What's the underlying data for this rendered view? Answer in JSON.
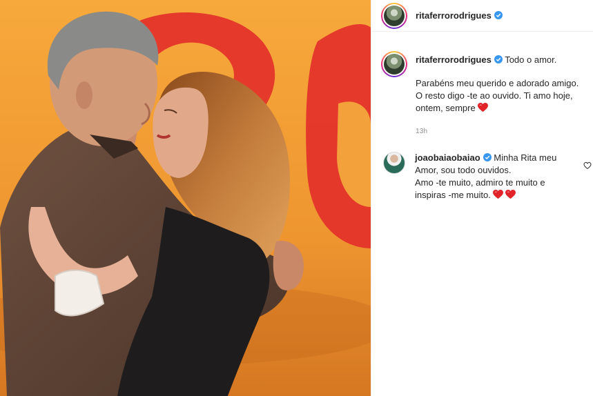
{
  "post": {
    "author": {
      "username": "ritaferrorodrigues",
      "verified": true
    },
    "caption": {
      "username": "ritaferrorodrigues",
      "first_line": "Todo o amor.",
      "lines": [
        "Parabéns meu querido e adorado amigo.",
        "O resto digo -te ao ouvido. Ti amo hoje,",
        "ontem, sempre"
      ],
      "emoji": "red-heart",
      "time": "13h"
    },
    "comments": [
      {
        "username": "joaobaiaobaiao",
        "verified": true,
        "lines": [
          "Minha Rita meu",
          "Amor, sou todo ouvidos.",
          "Amo -te muito, admiro te muito e",
          "inspiras -me muito."
        ],
        "emoji": [
          "red-heart",
          "red-heart"
        ],
        "like_icon": "heart-outline-icon"
      }
    ]
  },
  "colors": {
    "verified_blue": "#3897f0",
    "heart_red": "#e0242a",
    "secondary_text": "#8e8e8e",
    "photo_background": "#f09a2e"
  }
}
